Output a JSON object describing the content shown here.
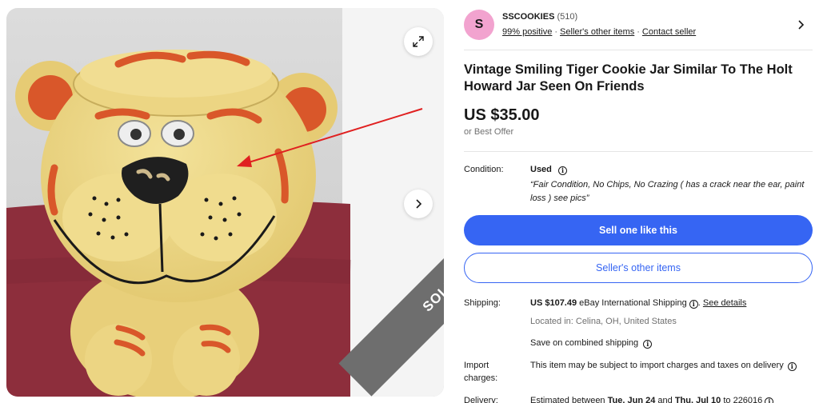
{
  "gallery": {
    "sold_label": "SOLD",
    "icons": {
      "expand": "expand-icon",
      "next": "chevron-right-icon"
    },
    "colors": {
      "tiger": "#ecd583",
      "stripes": "#d9572a",
      "cloth": "#8d2e3c",
      "ribbon": "#6e6e6e",
      "arrow": "#e02020"
    }
  },
  "seller": {
    "avatar_letter": "S",
    "name": "SSCOOKIES",
    "count": "(510)",
    "positive": "99% positive",
    "other_items": "Seller's other items",
    "contact": "Contact seller"
  },
  "listing": {
    "title": "Vintage Smiling Tiger Cookie Jar Similar To The Holt Howard Jar Seen On Friends",
    "price": "US $35.00",
    "best_offer": "or Best Offer"
  },
  "condition": {
    "label": "Condition:",
    "value": "Used",
    "note": "“Fair Condition, No Chips, No Crazing ( has a crack near the ear, paint loss ) see pics”"
  },
  "buttons": {
    "sell_one": "Sell one like this",
    "sellers_other": "Seller's other items"
  },
  "shipping": {
    "label": "Shipping:",
    "cost": "US $107.49",
    "method": "eBay International Shipping",
    "details_link": "See details",
    "location": "Located in: Celina, OH, United States",
    "combined": "Save on combined shipping"
  },
  "import": {
    "label_line1": "Import",
    "label_line2": "charges:",
    "text": "This item may be subject to import charges and taxes on delivery"
  },
  "delivery": {
    "label": "Delivery:",
    "prefix": "Estimated between",
    "start": "Tue, Jun 24",
    "and": "and",
    "end": "Thu, Jul 10",
    "to": "to 226016"
  },
  "colors": {
    "accent": "#3665f3",
    "avatar": "#f2a3cf",
    "muted": "#707070"
  }
}
